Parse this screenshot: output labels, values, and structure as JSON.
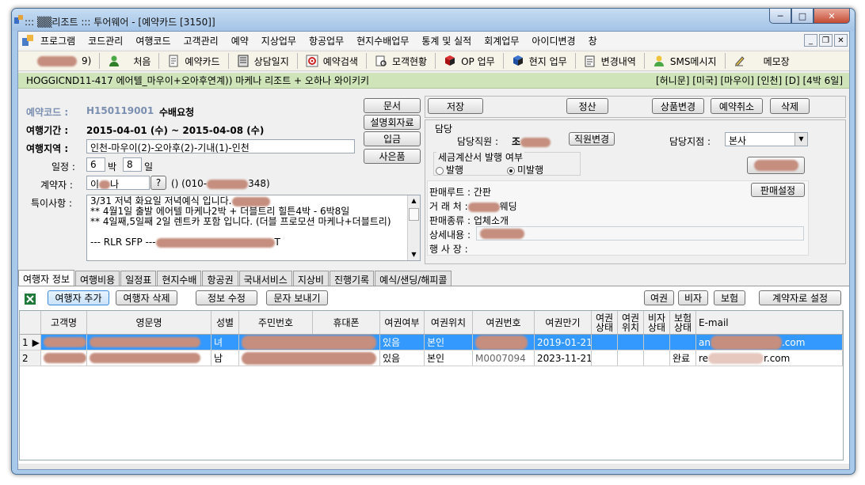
{
  "window": {
    "title": "::: ▒▒리조트 ::: 투어웨어 - [예약카드 [3150]]",
    "controls": {
      "minimize": "─",
      "maximize": "□",
      "close": "✕"
    }
  },
  "menu": {
    "items": [
      "프로그램",
      "코드관리",
      "여행코드",
      "고객관리",
      "예약",
      "지상업무",
      "항공업무",
      "현지수배업무",
      "통계 및 실적",
      "회계업무",
      "아이디변경",
      "창"
    ],
    "mdi": {
      "minimize": "_",
      "restore": "❐",
      "close": "✕"
    }
  },
  "toolbar": {
    "user_suffix": "9)",
    "items": [
      "처음",
      "예약카드",
      "상담일지",
      "예약검색",
      "모객현황",
      "OP 업무",
      "현지 업무",
      "변경내역",
      "SMS메시지",
      "메모장"
    ]
  },
  "product_bar": {
    "product": "HOGGICND11-417 에어텔_마우이+오아후연계)) 마케나 리조트 + 오하나 와이키키",
    "tags": "[허니문] [미국] [마우이] [인천] [D] [4박 6일]"
  },
  "reservation": {
    "code_label": "예약코드 :",
    "code": "H150119001",
    "status": "수배요청",
    "period_label": "여행기간 :",
    "period": "2015-04-01 (수) ~ 2015-04-08 (수)",
    "region_label": "여행지역 :",
    "region": "인천-마우이(2)-오아후(2)-기내(1)-인천",
    "schedule_label": "일정 :",
    "nights": "6",
    "nights_unit": "박",
    "days": "8",
    "days_unit": "일",
    "contractor_label": "계약자 :",
    "contractor_prefix": "이",
    "contractor_suffix": "나",
    "contractor_btn": "?",
    "contractor_phone_prefix": "() (010-",
    "contractor_phone_suffix": "348)",
    "notes_label": "특이사항 :",
    "notes": [
      "3/31 저녁 화요일 저녁예식 입니다.",
      "** 4월1일 출발 에어텔 마케나2박 + 더블트리 힐튼4박 - 6박8일",
      "** 4일째,5일째 2일 렌트카 포함 입니다. (더블 프로모션 마케나+더블트리)",
      "",
      "--- RLR SFP ---"
    ],
    "notes_tail": "T"
  },
  "side_buttons": [
    "문서",
    "설명회자료",
    "입금",
    "사은품"
  ],
  "actions": {
    "save": "저장",
    "settle": "정산",
    "change_product": "상품변경",
    "cancel_reservation": "예약취소",
    "delete": "삭제"
  },
  "staff": {
    "section": "담당",
    "staff_label": "담당직원 :",
    "staff_name_prefix": "조",
    "change_staff": "직원변경",
    "branch_label": "담당지점 :",
    "branch": "본사"
  },
  "tax_invoice": {
    "label": "세금계산서 발행 여부",
    "issued": "발행",
    "not_issued": "미발행",
    "selected": "not_issued"
  },
  "sales": {
    "route_label": "판매루트 :",
    "route": "간판",
    "client_label": "거 래 처 :",
    "client_suffix": "웨딩",
    "type_label": "판매종류 :",
    "type": "업체소개",
    "detail_label": "상세내용 :",
    "agency_label": "행 사 장 :",
    "setting_btn": "판매설정"
  },
  "tabs": [
    "여행자 정보",
    "여행비용",
    "일정표",
    "현지수배",
    "항공권",
    "국내서비스",
    "지상비",
    "진행기록",
    "예식/샌딩/해피콜"
  ],
  "traveler_toolbar": {
    "add": "여행자 추가",
    "remove": "여행자 삭제",
    "edit": "정보 수정",
    "sms": "문자 보내기",
    "passport": "여권",
    "visa": "비자",
    "insurance": "보험",
    "set_contractor": "계약자로 설정"
  },
  "grid": {
    "columns": [
      "고객명",
      "영문명",
      "성별",
      "주민번호",
      "휴대폰",
      "여권여부",
      "여권위치",
      "여권번호",
      "여권만기",
      "여권\n상태",
      "여권\n위치",
      "비자\n상태",
      "보험\n상태",
      "E-mail"
    ],
    "rows": [
      {
        "no": "1",
        "gender": "녀",
        "passport_yn": "있음",
        "passport_loc": "본인",
        "passport_exp": "2019-01-21",
        "insurance": "",
        "email_prefix": "an",
        "email_suffix": ".com",
        "selected": true
      },
      {
        "no": "2",
        "gender": "남",
        "passport_yn": "있음",
        "passport_loc": "본인",
        "passport_no_tail": "M0007094",
        "passport_exp": "2023-11-21",
        "insurance": "완료",
        "email_prefix": "re",
        "email_suffix": "r.com",
        "selected": false
      }
    ]
  }
}
